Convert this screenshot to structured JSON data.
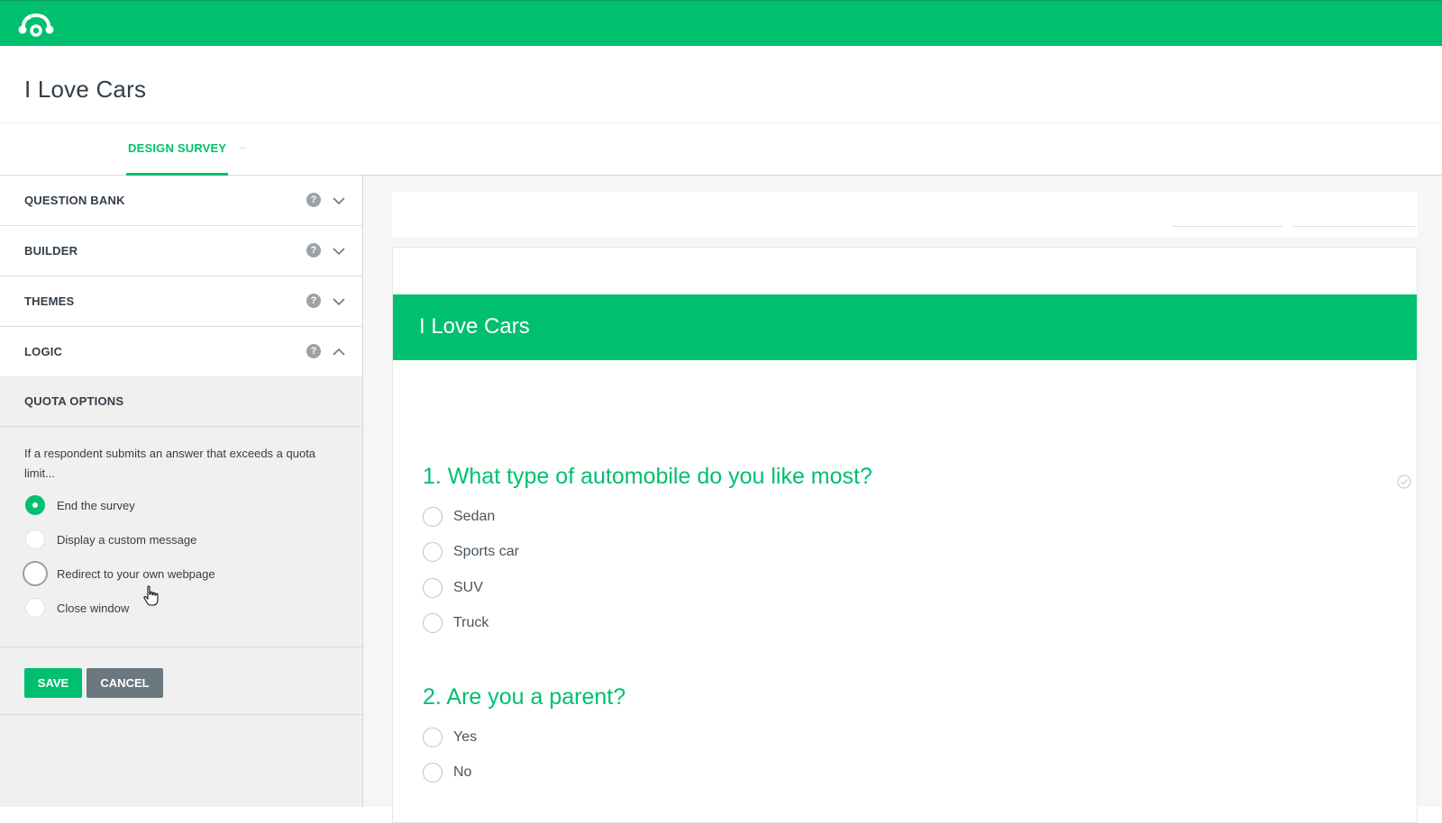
{
  "app": {
    "logo": "surveymonkey-logo-icon",
    "brand_color": "#00bf6f"
  },
  "page": {
    "title": "I Love Cars"
  },
  "tabs": {
    "active": "DESIGN SURVEY",
    "next_separator": "–"
  },
  "sidebar": {
    "sections": [
      {
        "label": "QUESTION BANK",
        "expanded": false,
        "help": "?"
      },
      {
        "label": "BUILDER",
        "expanded": false,
        "help": "?"
      },
      {
        "label": "THEMES",
        "expanded": false,
        "help": "?"
      },
      {
        "label": "LOGIC",
        "expanded": true,
        "help": "?"
      }
    ],
    "quota": {
      "heading": "QUOTA OPTIONS",
      "description": "If a respondent submits an answer that exceeds a quota limit...",
      "options": [
        {
          "label": "End the survey",
          "selected": true
        },
        {
          "label": "Display a custom message",
          "selected": false
        },
        {
          "label": "Redirect to your own webpage",
          "selected": false
        },
        {
          "label": "Close window",
          "selected": false
        }
      ],
      "save_label": "SAVE",
      "cancel_label": "CANCEL"
    }
  },
  "survey": {
    "title": "I Love Cars",
    "questions": [
      {
        "title": "1. What type of automobile do you like most?",
        "answers": [
          "Sedan",
          "Sports car",
          "SUV",
          "Truck"
        ]
      },
      {
        "title": "2. Are you a parent?",
        "answers": [
          "Yes",
          "No"
        ]
      }
    ]
  }
}
